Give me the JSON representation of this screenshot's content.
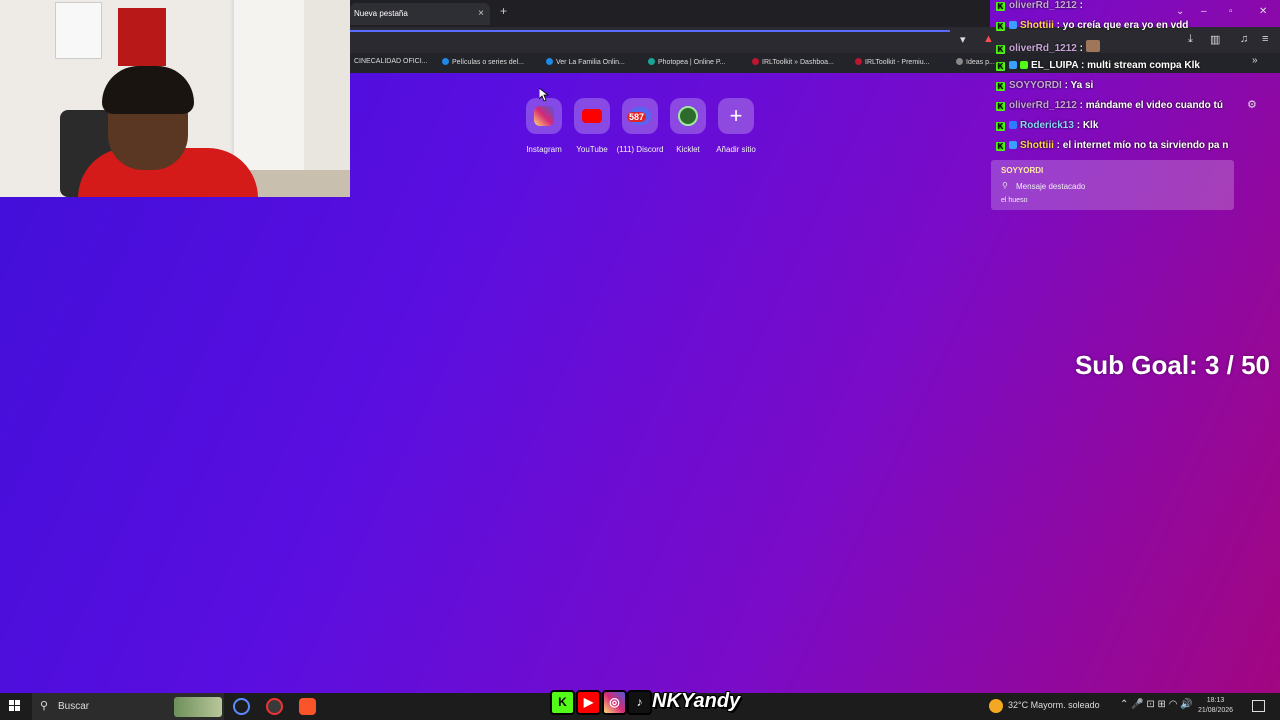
{
  "browser": {
    "tab_title": "Nueva pestaña",
    "close_glyph": "×",
    "new_tab_glyph": "+",
    "bookmarks": [
      {
        "label": "CINECALIDAD OFICI...",
        "color": "#2f2f2f"
      },
      {
        "label": "Películas o series del...",
        "color": "#1e88e5"
      },
      {
        "label": "Ver La Familia Onlin...",
        "color": "#1e88e5"
      },
      {
        "label": "Photopea | Online P...",
        "color": "#18a497"
      },
      {
        "label": "IRLToolkit » Dashboa...",
        "color": "#c0152f"
      },
      {
        "label": "IRLToolkit - Premiu...",
        "color": "#c0152f"
      },
      {
        "label": "Ideas p...",
        "color": "#888888"
      }
    ],
    "more_glyph": "»"
  },
  "shortcuts": [
    {
      "label": "Instagram",
      "icon": "instagram-icon",
      "color": "#d6249f"
    },
    {
      "label": "YouTube",
      "icon": "youtube-icon",
      "color": "#ff0000"
    },
    {
      "label": "(111) Discord",
      "icon": "discord-icon",
      "color": "#5865f2",
      "badge": "587"
    },
    {
      "label": "Kicklet",
      "icon": "kicklet-icon",
      "color": "#2d6b2d"
    },
    {
      "label": "Añadir sitio",
      "icon": "plus-icon",
      "color": "#ffffff",
      "glyph": "+"
    }
  ],
  "chat": {
    "messages": [
      {
        "user": "oliverRd_1212",
        "text": "",
        "user_color": "#c8a6d8"
      },
      {
        "user": "Shottiii",
        "text": "yo creía que era yo en vdd",
        "user_color": "#ffd54a"
      },
      {
        "user": "oliverRd_1212",
        "text": "",
        "user_color": "#c8a6d8"
      },
      {
        "user": "EL_LUIPA",
        "text": "multi stream compa Klk",
        "user_color": "#ffffff"
      },
      {
        "user": "SOYYORDI",
        "text": "Ya si",
        "user_color": "#c8a6d8"
      },
      {
        "user": "oliverRd_1212",
        "text": "mándame el video cuando tú",
        "user_color": "#c8a6d8"
      },
      {
        "user": "Roderick13",
        "text": "Klk",
        "user_color": "#8fd3ff"
      },
      {
        "user": "Shottiii",
        "text": "el internet mío no ta sirviendo pa n",
        "user_color": "#ffd54a"
      }
    ],
    "separator": ":",
    "pinned": {
      "user": "SOYYORDI",
      "title": "Mensaje destacado",
      "body": "el hueso"
    }
  },
  "sub_goal": "Sub Goal: 3 / 50",
  "overlay": {
    "brand": "NKYandy",
    "kick_glyph": "K"
  },
  "taskbar": {
    "search_placeholder": "Buscar",
    "weather": "32°C  Mayorm. soleado",
    "time": "18:13",
    "date": "21/08/2026"
  }
}
